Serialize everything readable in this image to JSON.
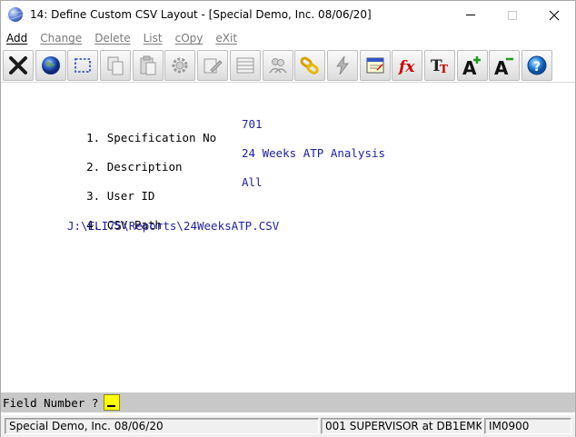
{
  "window": {
    "title": "14: Define Custom CSV Layout - [Special Demo, Inc. 08/06/20]"
  },
  "menu": {
    "items": [
      {
        "label": "Add",
        "enabled": true
      },
      {
        "label": "Change",
        "enabled": false
      },
      {
        "label": "Delete",
        "enabled": false
      },
      {
        "label": "List",
        "enabled": false
      },
      {
        "label": "cOpy",
        "enabled": false
      },
      {
        "label": "eXit",
        "enabled": false
      }
    ]
  },
  "toolbar": {
    "buttons": [
      "close-x-icon",
      "globe-icon",
      "select-box-icon",
      "copy-pages-icon",
      "paste-clipboard-icon",
      "gear-icon",
      "edit-pencil-icon",
      "table-list-icon",
      "users-icon",
      "chain-link-icon",
      "lightning-icon",
      "calendar-window-icon",
      "function-fx-icon",
      "font-size-icon",
      "font-increase-icon",
      "font-decrease-icon",
      "help-icon"
    ]
  },
  "form": {
    "fields": [
      {
        "num": "1.",
        "label": "Specification No",
        "value": "701"
      },
      {
        "num": "2.",
        "label": "Description",
        "value": "24 Weeks ATP Analysis"
      },
      {
        "num": "3.",
        "label": "User ID",
        "value": "All"
      },
      {
        "num": "4.",
        "label": "CSV Path",
        "value": "J:\\ELI75\\Reports\\24WeeksATP.CSV"
      }
    ]
  },
  "prompt": {
    "label": "Field Number ?"
  },
  "status": {
    "company": "Special Demo, Inc. 08/06/20",
    "user": "001 SUPERVISOR at DB1EMK",
    "program": "IM0900"
  },
  "colors": {
    "value_text": "#1f1f9f",
    "prompt_bar": "#c8c8c8",
    "prompt_input": "#ffff00"
  }
}
